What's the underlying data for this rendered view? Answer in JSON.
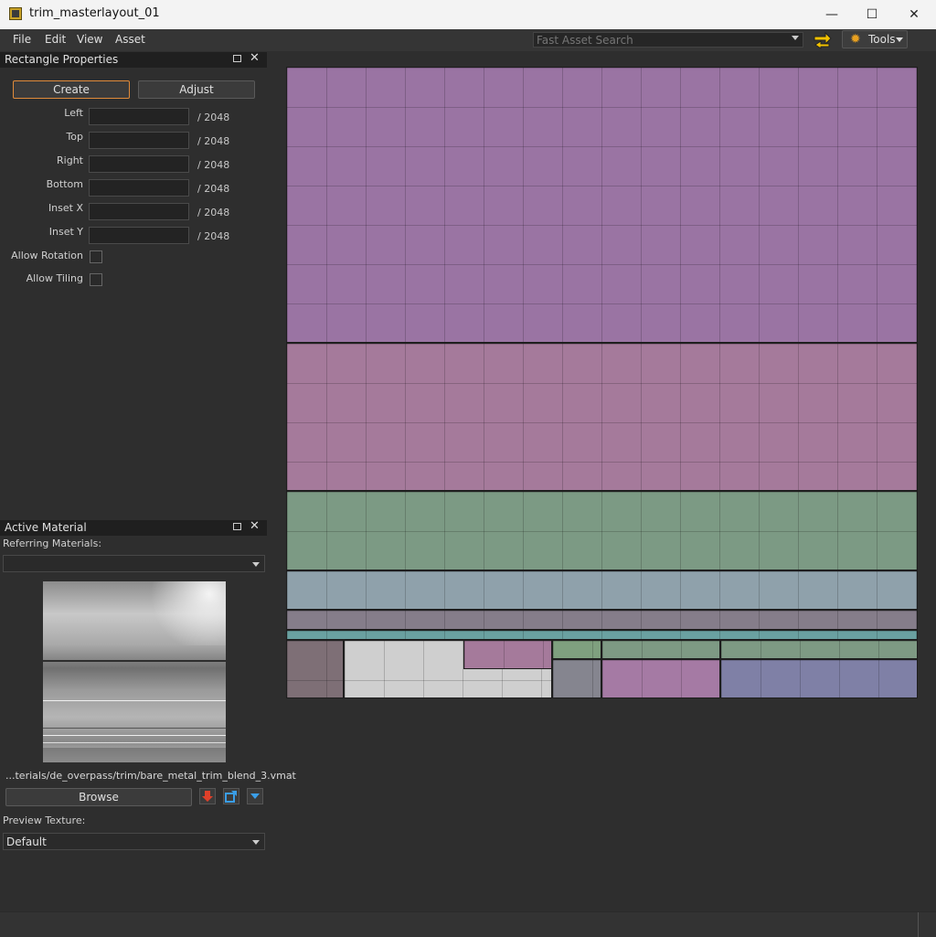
{
  "window": {
    "title": "trim_masterlayout_01",
    "minimize_label": "—",
    "maximize_label": "☐",
    "close_label": "✕"
  },
  "menu": {
    "items": [
      "File",
      "Edit",
      "View",
      "Asset"
    ]
  },
  "toolbar": {
    "search_placeholder": "Fast Asset Search",
    "tools_label": "Tools"
  },
  "rectangle_properties": {
    "title": "Rectangle Properties",
    "create_label": "Create",
    "adjust_label": "Adjust",
    "fields": [
      {
        "label": "Left",
        "value": "",
        "suffix": "/ 2048"
      },
      {
        "label": "Top",
        "value": "",
        "suffix": "/ 2048"
      },
      {
        "label": "Right",
        "value": "",
        "suffix": "/ 2048"
      },
      {
        "label": "Bottom",
        "value": "",
        "suffix": "/ 2048"
      },
      {
        "label": "Inset X",
        "value": "",
        "suffix": "/ 2048"
      },
      {
        "label": "Inset Y",
        "value": "",
        "suffix": "/ 2048"
      }
    ],
    "allow_rotation_label": "Allow Rotation",
    "allow_rotation_checked": false,
    "allow_tiling_label": "Allow Tiling",
    "allow_tiling_checked": false
  },
  "active_material": {
    "title": "Active Material",
    "referring_label": "Referring Materials:",
    "referring_value": "",
    "material_path": "...terials/de_overpass/trim/bare_metal_trim_blend_3.vmat",
    "browse_label": "Browse",
    "preview_texture_label": "Preview Texture:",
    "preview_texture_value": "Default"
  },
  "colors": {
    "accent_orange": "#e08a3a",
    "purple": "#9a74a3",
    "pink_purple": "#a57a9b",
    "green": "#7c9a84",
    "blue_gray": "#8fa1ab",
    "teal": "#6aa1a1",
    "indigo": "#7f80a6"
  }
}
